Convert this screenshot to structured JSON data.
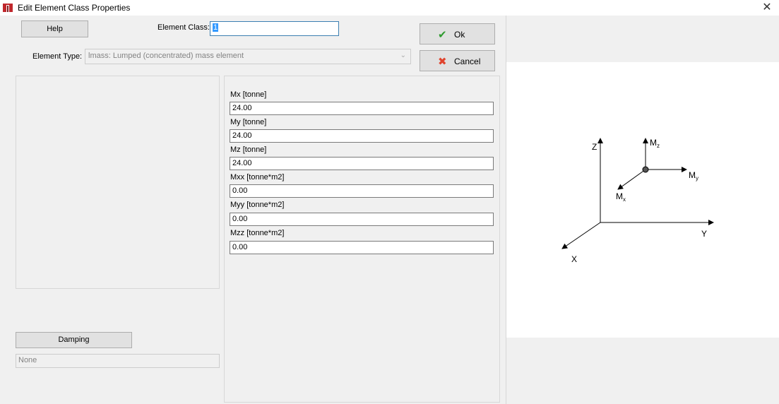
{
  "window": {
    "title": "Edit Element Class Properties",
    "close_glyph": "✕"
  },
  "toolbar": {
    "help_label": "Help",
    "ok_label": "Ok",
    "cancel_label": "Cancel",
    "ok_icon": "checkmark-icon",
    "cancel_icon": "x-icon",
    "ok_icon_color": "#2f9b2f",
    "cancel_icon_color": "#e0442e"
  },
  "element_class": {
    "label": "Element Class:",
    "value": "1"
  },
  "element_type": {
    "label": "Element Type:",
    "value": "lmass: Lumped (concentrated) mass element"
  },
  "fields": [
    {
      "label": "Mx [tonne]",
      "value": "24.00"
    },
    {
      "label": "My [tonne]",
      "value": "24.00"
    },
    {
      "label": "Mz [tonne]",
      "value": "24.00"
    },
    {
      "label": "Mxx [tonne*m2]",
      "value": "0.00"
    },
    {
      "label": "Myy [tonne*m2]",
      "value": "0.00"
    },
    {
      "label": "Mzz [tonne*m2]",
      "value": "0.00"
    }
  ],
  "damping": {
    "button_label": "Damping",
    "value": "None"
  },
  "diagram": {
    "axis_z": "Z",
    "axis_y": "Y",
    "axis_x": "X",
    "mz": "M",
    "mz_sub": "z",
    "my": "M",
    "my_sub": "y",
    "mx": "M",
    "mx_sub": "x"
  }
}
